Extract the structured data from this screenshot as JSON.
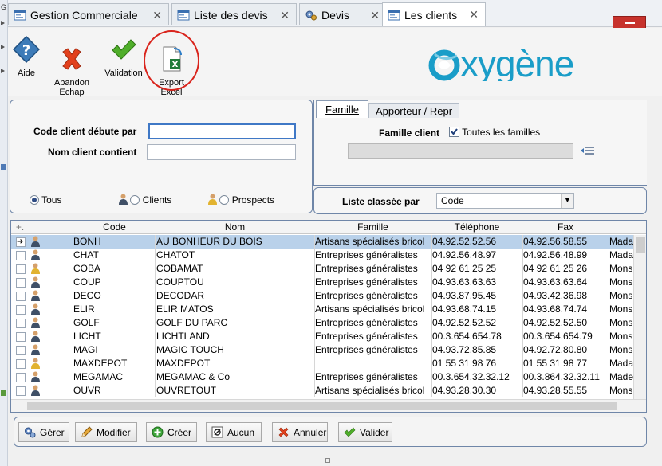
{
  "tabs": [
    {
      "label": "Gestion Commerciale",
      "active": false
    },
    {
      "label": "Liste des devis",
      "active": false
    },
    {
      "label": "Devis",
      "active": false
    },
    {
      "label": "Les clients",
      "active": true
    }
  ],
  "toolbar": {
    "aide": "Aide",
    "abandon": "Abandon\nEchap",
    "validation": "Validation",
    "export": "Export\nExcel"
  },
  "logo_text": "oxygène",
  "filters": {
    "code_label": "Code client débute par",
    "code_value": "",
    "nom_label": "Nom client contient",
    "nom_value": "",
    "radio_tous": "Tous",
    "radio_clients": "Clients",
    "radio_prospects": "Prospects",
    "selected": "Tous"
  },
  "right_tabs": {
    "famille": "Famille",
    "apporteur": "Apporteur / Repr"
  },
  "famille": {
    "label": "Famille client",
    "checkbox_label": "Toutes les familles",
    "checked": true
  },
  "sort": {
    "label": "Liste classée par",
    "value": "Code"
  },
  "grid": {
    "columns": [
      "Code",
      "Nom",
      "Famille",
      "Téléphone",
      "Fax"
    ],
    "rows": [
      {
        "code": "BONH",
        "nom": "AU BONHEUR DU BOIS",
        "famille": "Artisans spécialisés bricol",
        "tel": "04.92.52.52.56",
        "fax": "04.92.56.58.55",
        "extra": "Mada",
        "selected": true
      },
      {
        "code": "CHAT",
        "nom": "CHATOT",
        "famille": "Entreprises généralistes",
        "tel": "04.92.56.48.97",
        "fax": "04.92.56.48.99",
        "extra": "Mada"
      },
      {
        "code": "COBA",
        "nom": "COBAMAT",
        "famille": "Entreprises généralistes",
        "tel": "04 92 61 25 25",
        "fax": "04 92 61 25 26",
        "extra": "Mons"
      },
      {
        "code": "COUP",
        "nom": "COUPTOU",
        "famille": "Entreprises généralistes",
        "tel": "04.93.63.63.63",
        "fax": "04.93.63.63.64",
        "extra": "Mons"
      },
      {
        "code": "DECO",
        "nom": "DECODAR",
        "famille": "Entreprises généralistes",
        "tel": "04.93.87.95.45",
        "fax": "04.93.42.36.98",
        "extra": "Mons"
      },
      {
        "code": "ELIR",
        "nom": "ELIR MATOS",
        "famille": "Artisans spécialisés bricol",
        "tel": "04.93.68.74.15",
        "fax": "04.93.68.74.74",
        "extra": "Mons"
      },
      {
        "code": "GOLF",
        "nom": "GOLF DU PARC",
        "famille": "Entreprises généralistes",
        "tel": "04.92.52.52.52",
        "fax": "04.92.52.52.50",
        "extra": "Mons"
      },
      {
        "code": "LICHT",
        "nom": "LICHTLAND",
        "famille": "Entreprises généralistes",
        "tel": "00.3.654.654.78",
        "fax": "00.3.654.654.79",
        "extra": "Mons"
      },
      {
        "code": "MAGI",
        "nom": "MAGIC TOUCH",
        "famille": "Entreprises généralistes",
        "tel": "04.93.72.85.85",
        "fax": "04.92.72.80.80",
        "extra": "Mons"
      },
      {
        "code": "MAXDEPOT",
        "nom": "MAXDEPOT",
        "famille": "",
        "tel": "01 55 31 98 76",
        "fax": "01 55 31 98 77",
        "extra": "Mada"
      },
      {
        "code": "MEGAMAC",
        "nom": "MEGAMAC & Co",
        "famille": "Entreprises généralistes",
        "tel": "00.3.654.32.32.12",
        "fax": "00.3.864.32.32.11",
        "extra": "Made"
      },
      {
        "code": "OUVR",
        "nom": "OUVRETOUT",
        "famille": "Artisans spécialisés bricol",
        "tel": "04.93.28.30.30",
        "fax": "04.93.28.55.55",
        "extra": "Mons"
      }
    ]
  },
  "buttons": {
    "gerer": "Gérer",
    "modifier": "Modifier",
    "creer": "Créer",
    "aucun": "Aucun",
    "annuler": "Annuler",
    "valider": "Valider"
  },
  "colors": {
    "accent": "#1a9dc8",
    "selection": "#b9d1ea",
    "export_highlight": "#d9241c"
  }
}
